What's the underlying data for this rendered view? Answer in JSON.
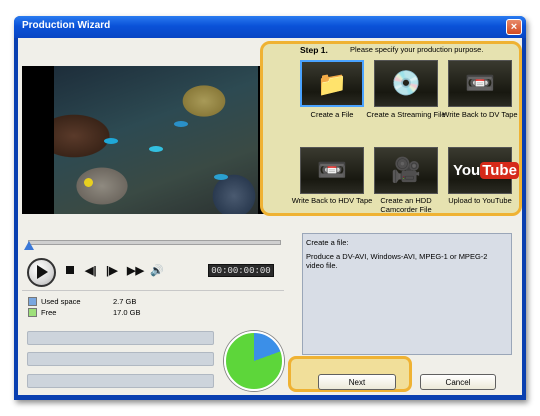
{
  "window": {
    "title": "Production Wizard",
    "close_glyph": "×"
  },
  "player": {
    "time": "00:00:00:00"
  },
  "disk": {
    "items": [
      {
        "label": "Used space",
        "value": "2.7  GB",
        "color": "#7aa7e0"
      },
      {
        "label": "Free",
        "value": "17.0  GB",
        "color": "#9ee07a"
      }
    ]
  },
  "step": {
    "label": "Step 1.",
    "instruction": "Please specify your production purpose."
  },
  "options": [
    {
      "label": "Create a File",
      "icon": "folder-icon",
      "selected": true
    },
    {
      "label": "Create a Streaming File",
      "icon": "streaming-disc-icon",
      "selected": false
    },
    {
      "label": "Write Back to DV Tape",
      "icon": "dv-tape-icon",
      "selected": false
    },
    {
      "label": "Write Back to HDV Tape",
      "icon": "hdv-tape-icon",
      "selected": false
    },
    {
      "label": "Create an HDD Camcorder File",
      "icon": "camcorder-icon",
      "selected": false
    },
    {
      "label": "Upload to YouTube",
      "icon": "youtube-icon",
      "selected": false
    }
  ],
  "description": {
    "title": "Create a file:",
    "text": "Produce a DV-AVI, Windows-AVI, MPEG-1 or MPEG-2 video file."
  },
  "buttons": {
    "next": "Next",
    "cancel": "Cancel"
  },
  "colors": {
    "highlight": "#efb233",
    "title_bar": "#0a52d8",
    "accent": "#3b8fe8"
  }
}
